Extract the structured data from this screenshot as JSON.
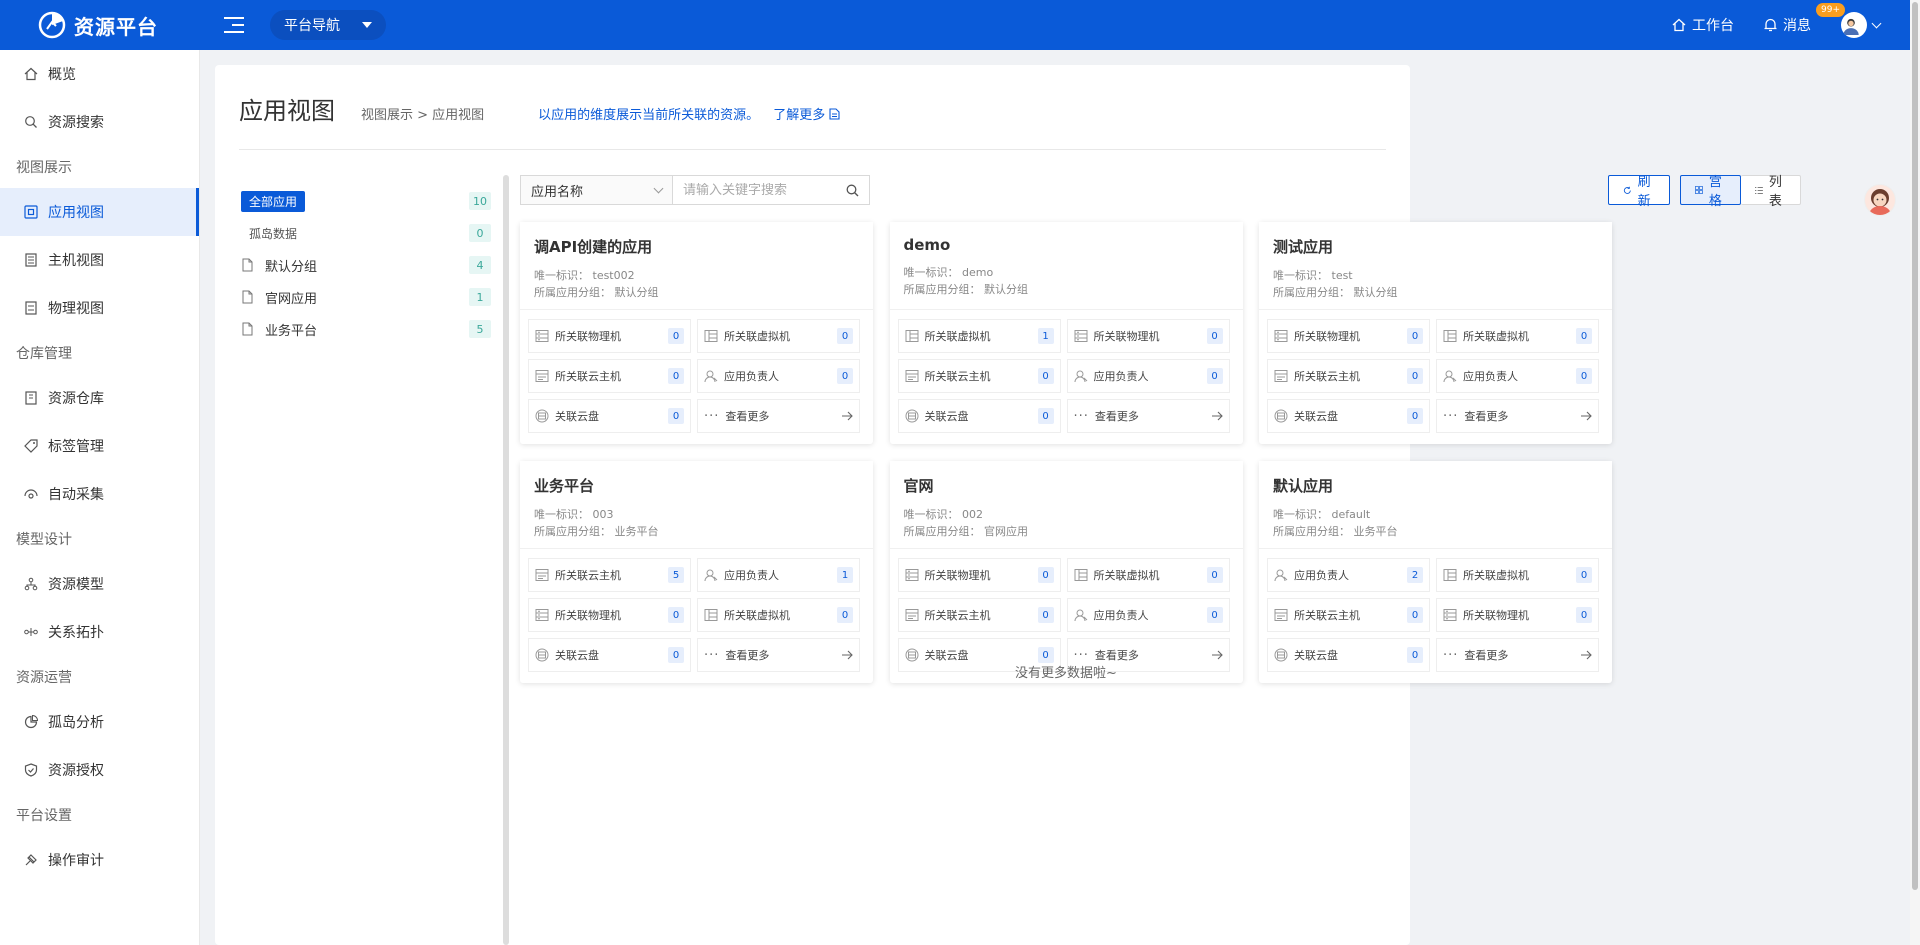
{
  "header": {
    "app_name": "资源平台",
    "nav_select": "平台导航",
    "workbench": "工作台",
    "messages": "消息",
    "message_badge": "99+"
  },
  "sidebar": {
    "items": [
      {
        "label": "概览",
        "icon": "home-icon"
      },
      {
        "label": "资源搜索",
        "icon": "search-icon"
      }
    ],
    "groups": [
      {
        "title": "视图展示",
        "items": [
          {
            "label": "应用视图",
            "icon": "app-view-icon",
            "active": true
          },
          {
            "label": "主机视图",
            "icon": "host-icon"
          },
          {
            "label": "物理视图",
            "icon": "physical-icon"
          }
        ]
      },
      {
        "title": "仓库管理",
        "items": [
          {
            "label": "资源仓库",
            "icon": "warehouse-icon"
          },
          {
            "label": "标签管理",
            "icon": "tag-icon"
          },
          {
            "label": "自动采集",
            "icon": "collect-icon"
          }
        ]
      },
      {
        "title": "模型设计",
        "items": [
          {
            "label": "资源模型",
            "icon": "model-icon"
          },
          {
            "label": "关系拓扑",
            "icon": "topology-icon"
          }
        ]
      },
      {
        "title": "资源运营",
        "items": [
          {
            "label": "孤岛分析",
            "icon": "pie-icon"
          },
          {
            "label": "资源授权",
            "icon": "shield-icon"
          }
        ]
      },
      {
        "title": "平台设置",
        "items": [
          {
            "label": "操作审计",
            "icon": "audit-icon"
          }
        ]
      }
    ]
  },
  "page": {
    "title": "应用视图",
    "breadcrumb": "视图展示 > 应用视图",
    "description": "以应用的维度展示当前所关联的资源。",
    "learn_more": "了解更多"
  },
  "tree": {
    "all_label": "全部应用",
    "all_count": "10",
    "items": [
      {
        "label": "孤岛数据",
        "count": "0",
        "folder": false
      },
      {
        "label": "默认分组",
        "count": "4",
        "folder": true
      },
      {
        "label": "官网应用",
        "count": "1",
        "folder": true
      },
      {
        "label": "业务平台",
        "count": "5",
        "folder": true
      }
    ]
  },
  "search": {
    "field": "应用名称",
    "placeholder": "请输入关键字搜索"
  },
  "toolbar": {
    "refresh": "刷新",
    "grid": "宫格",
    "list": "列表"
  },
  "labels": {
    "uid": "唯一标识：",
    "group": "所属应用分组："
  },
  "cards": [
    {
      "name": "调API创建的应用",
      "uid": "test002",
      "group": "默认分组",
      "cells": [
        {
          "label": "所关联物理机",
          "count": "0",
          "icon": "server-icon"
        },
        {
          "label": "所关联虚拟机",
          "count": "0",
          "icon": "vm-icon"
        },
        {
          "label": "所关联云主机",
          "count": "0",
          "icon": "cloud-host-icon"
        },
        {
          "label": "应用负责人",
          "count": "0",
          "icon": "user-icon"
        },
        {
          "label": "关联云盘",
          "count": "0",
          "icon": "disk-icon"
        }
      ]
    },
    {
      "name": "demo",
      "uid": "demo",
      "group": "默认分组",
      "cells": [
        {
          "label": "所关联虚拟机",
          "count": "1",
          "icon": "vm-icon"
        },
        {
          "label": "所关联物理机",
          "count": "0",
          "icon": "server-icon"
        },
        {
          "label": "所关联云主机",
          "count": "0",
          "icon": "cloud-host-icon"
        },
        {
          "label": "应用负责人",
          "count": "0",
          "icon": "user-icon"
        },
        {
          "label": "关联云盘",
          "count": "0",
          "icon": "disk-icon"
        }
      ]
    },
    {
      "name": "测试应用",
      "uid": "test",
      "group": "默认分组",
      "cells": [
        {
          "label": "所关联物理机",
          "count": "0",
          "icon": "server-icon"
        },
        {
          "label": "所关联虚拟机",
          "count": "0",
          "icon": "vm-icon"
        },
        {
          "label": "所关联云主机",
          "count": "0",
          "icon": "cloud-host-icon"
        },
        {
          "label": "应用负责人",
          "count": "0",
          "icon": "user-icon"
        },
        {
          "label": "关联云盘",
          "count": "0",
          "icon": "disk-icon"
        }
      ]
    },
    {
      "name": "业务平台",
      "uid": "003",
      "group": "业务平台",
      "cells": [
        {
          "label": "所关联云主机",
          "count": "5",
          "icon": "cloud-host-icon"
        },
        {
          "label": "应用负责人",
          "count": "1",
          "icon": "user-icon"
        },
        {
          "label": "所关联物理机",
          "count": "0",
          "icon": "server-icon"
        },
        {
          "label": "所关联虚拟机",
          "count": "0",
          "icon": "vm-icon"
        },
        {
          "label": "关联云盘",
          "count": "0",
          "icon": "disk-icon"
        }
      ]
    },
    {
      "name": "官网",
      "uid": "002",
      "group": "官网应用",
      "cells": [
        {
          "label": "所关联物理机",
          "count": "0",
          "icon": "server-icon"
        },
        {
          "label": "所关联虚拟机",
          "count": "0",
          "icon": "vm-icon"
        },
        {
          "label": "所关联云主机",
          "count": "0",
          "icon": "cloud-host-icon"
        },
        {
          "label": "应用负责人",
          "count": "0",
          "icon": "user-icon"
        },
        {
          "label": "关联云盘",
          "count": "0",
          "icon": "disk-icon"
        }
      ]
    },
    {
      "name": "默认应用",
      "uid": "default",
      "group": "业务平台",
      "cells": [
        {
          "label": "应用负责人",
          "count": "2",
          "icon": "user-icon"
        },
        {
          "label": "所关联虚拟机",
          "count": "0",
          "icon": "vm-icon"
        },
        {
          "label": "所关联云主机",
          "count": "0",
          "icon": "cloud-host-icon"
        },
        {
          "label": "所关联物理机",
          "count": "0",
          "icon": "server-icon"
        },
        {
          "label": "关联云盘",
          "count": "0",
          "icon": "disk-icon"
        }
      ]
    }
  ],
  "see_more": "查看更多",
  "no_more": "没有更多数据啦~",
  "colors": {
    "primary": "#0a5ad8",
    "count_bg": "#e6f6f4",
    "badge": "#fa9e1e"
  }
}
